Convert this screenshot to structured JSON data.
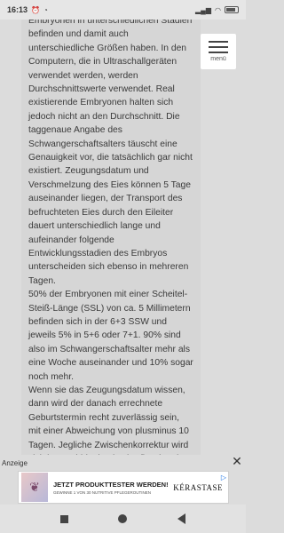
{
  "status_bar": {
    "time": "16:13",
    "left_icons": [
      "alarm-icon",
      "notification-icon"
    ],
    "right_icons": [
      "signal-icon",
      "wifi-icon",
      "battery-icon"
    ]
  },
  "menu": {
    "label": "menü"
  },
  "article": {
    "paragraphs": [
      "Embryonen in unterschiedlichen Stadien befinden und damit auch unterschiedliche Größen haben. In den Computern, die in Ultraschallgeräten verwendet werden, werden Durchschnittswerte verwendet. Real existierende Embryonen halten sich jedoch nicht an den Durchschnitt. Die taggenaue Angabe des Schwangerschaftsalters täuscht eine Genauigkeit vor, die tatsächlich gar nicht existiert. Zeugungsdatum und Verschmelzung des Eies können 5 Tage auseinander liegen, der Transport des befruchteten Eies durch den Eileiter dauert unterschiedlich lange und aufeinander folgende Entwicklungsstadien des Embryos unterscheiden sich ebenso in mehreren Tagen.",
      "50% der Embryonen mit einer Scheitel-Steiß-Länge (SSL) von ca. 5 Millimetern befinden sich in der 6+3 SSW und jeweils 5% in 5+6 oder 7+1. 90% sind also im Schwangerschaftsalter mehr als eine Woche auseinander und 10% sogar noch mehr.",
      "Wenn sie das Zeugungsdatum wissen, dann wird der danach errechnete Geburtstermin recht zuverlässig sein, mit einer Abweichung von plusminus 10 Tagen. Jegliche Zwischenkorrektur wird sich im Nachhinein als überflüssig oder falsch rausstellen."
    ]
  },
  "ad": {
    "label": "Anzeige",
    "title": "JETZT PRODUKTTESTER WERDEN!",
    "subtitle": "GEWINNE 1 VON 30 NUTRITIVE PFLEGEROUTINEN",
    "brand": "KÉRASTASE"
  },
  "nav": {
    "buttons": [
      "recents",
      "home",
      "back"
    ]
  }
}
